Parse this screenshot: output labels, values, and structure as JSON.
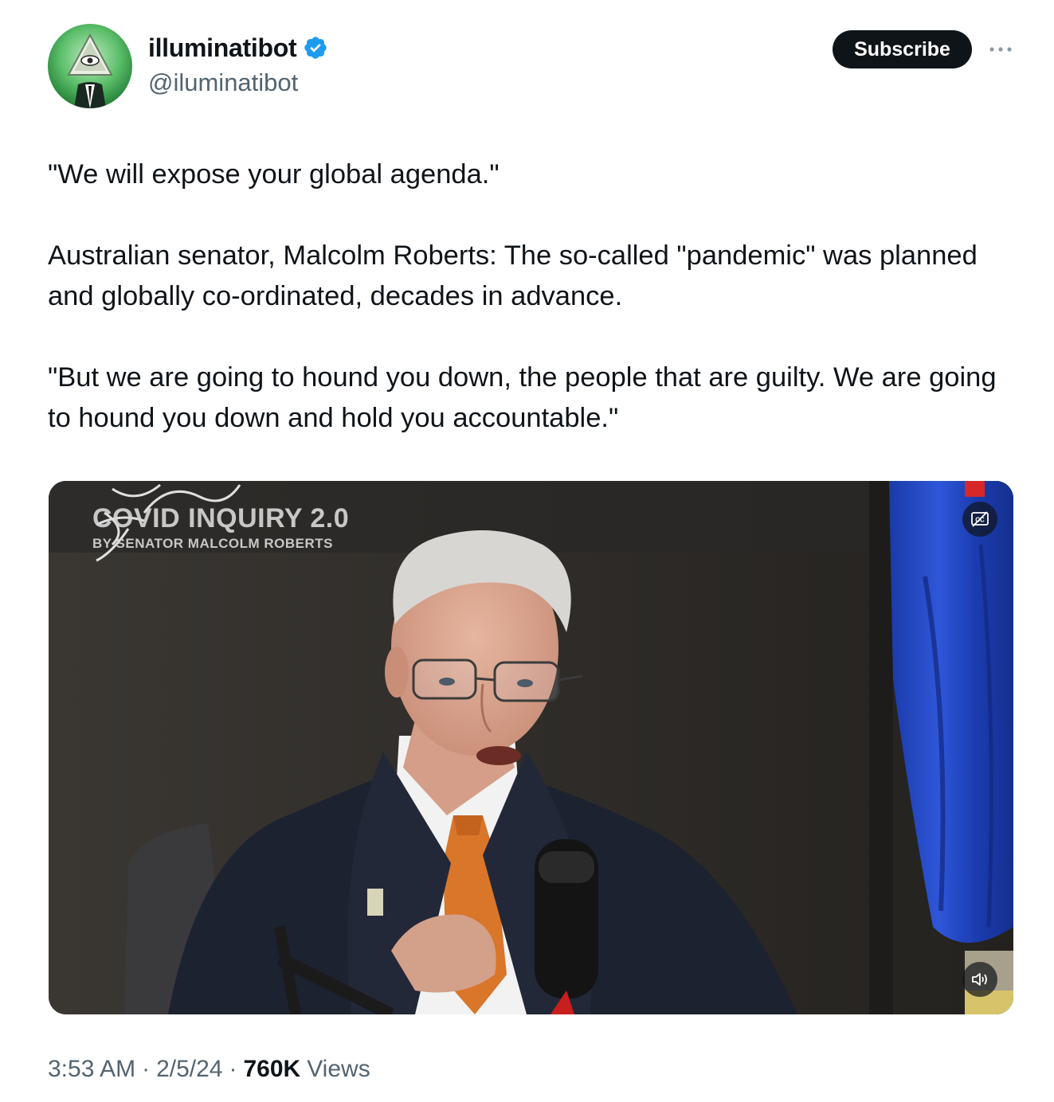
{
  "author": {
    "display_name": "illuminatibot",
    "handle": "@iluminatibot",
    "verified": true,
    "avatar_icon": "eye-pyramid-avatar-icon"
  },
  "actions": {
    "subscribe_label": "Subscribe",
    "more_icon": "more-horizontal-icon"
  },
  "tweet": {
    "paragraphs": [
      "\"We will expose your global agenda.\"",
      "Australian senator, Malcolm Roberts: The so-called \"pandemic\" was planned and globally co-ordinated, decades in advance.",
      "\"But we are going to hound you down, the people that are guilty. We are going to hound you down and hold you accountable.\""
    ]
  },
  "media": {
    "overlay_title": "COVID INQUIRY 2.0",
    "overlay_subtitle": "BY SENATOR MALCOLM ROBERTS",
    "captions_icon": "closed-captions-icon",
    "volume_icon": "volume-icon"
  },
  "meta": {
    "time": "3:53 AM",
    "separator": "·",
    "date": "2/5/24",
    "views_count": "760K",
    "views_label": "Views"
  },
  "colors": {
    "text_primary": "#0f1419",
    "text_secondary": "#536471",
    "verified_blue": "#1d9bf0",
    "subscribe_bg": "#0f1419"
  }
}
